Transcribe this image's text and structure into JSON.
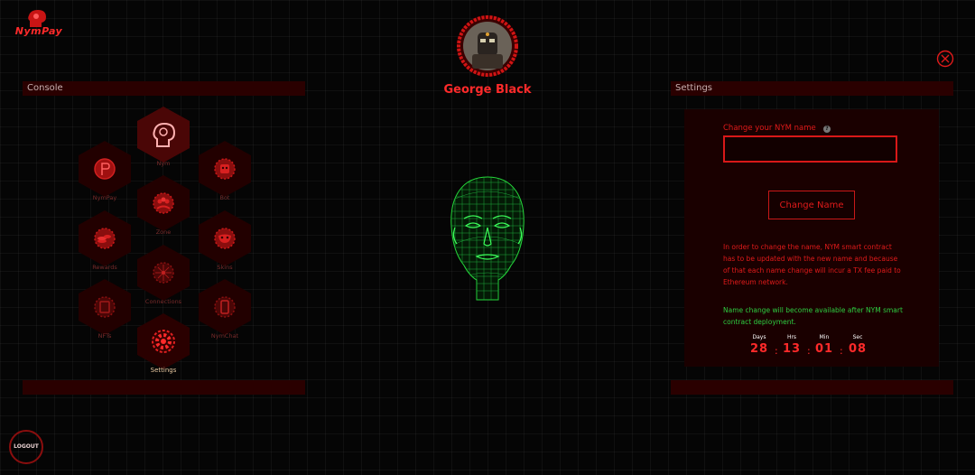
{
  "brand": {
    "name": "NymPay"
  },
  "profile": {
    "name": "George Black"
  },
  "console": {
    "title": "Console",
    "items": [
      {
        "label": "Nym",
        "icon": "head-profile-icon"
      },
      {
        "label": "NymPay",
        "icon": "coin-icon"
      },
      {
        "label": "Bot",
        "icon": "bot-icon"
      },
      {
        "label": "Zone",
        "icon": "group-icon"
      },
      {
        "label": "Rewards",
        "icon": "coins-stack-icon"
      },
      {
        "label": "Skins",
        "icon": "mask-icon"
      },
      {
        "label": "Connections",
        "icon": "network-icon"
      },
      {
        "label": "NFTs",
        "icon": "nft-icon"
      },
      {
        "label": "NymChat",
        "icon": "phone-chat-icon"
      },
      {
        "label": "Settings",
        "icon": "gear-icon"
      }
    ]
  },
  "settings": {
    "title": "Settings",
    "name_label": "Change your NYM name",
    "name_value": "",
    "button_label": "Change Name",
    "info": "In order to change the name, NYM smart contract has to be updated with the new name and because of that each name change will incur a TX fee paid to Ethereum network.",
    "availability": "Name change will become available after NYM smart contract deployment.",
    "countdown": [
      {
        "unit": "Days",
        "value": "28"
      },
      {
        "unit": "Hrs",
        "value": "13"
      },
      {
        "unit": "Min",
        "value": "01"
      },
      {
        "unit": "Sec",
        "value": "08"
      }
    ]
  },
  "logout": {
    "label": "LOGOUT"
  },
  "colors": {
    "accent": "#e01a1a",
    "success": "#2ecc40",
    "panel": "#2a0000"
  }
}
